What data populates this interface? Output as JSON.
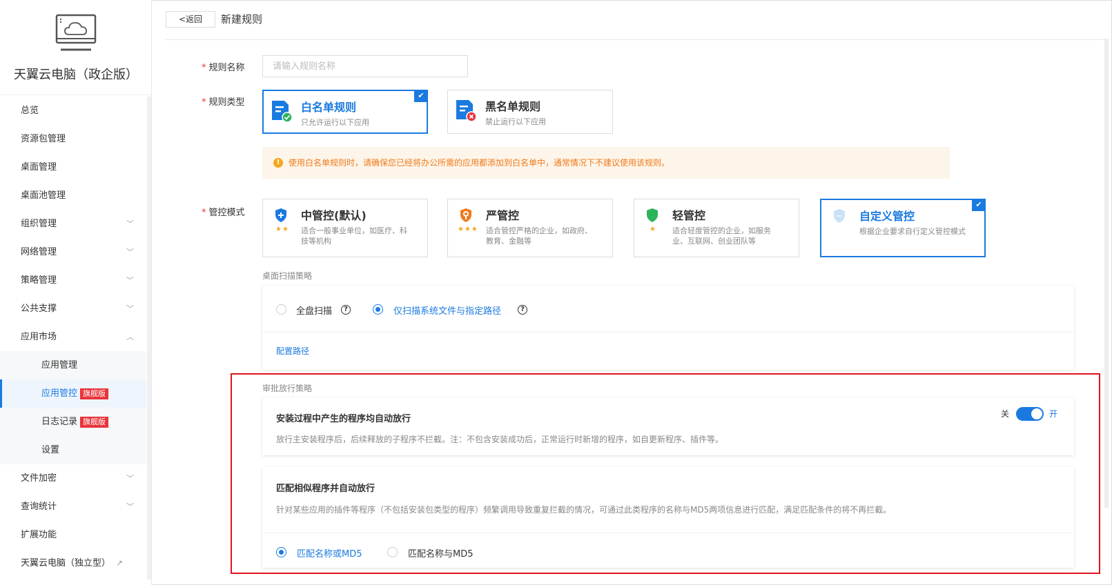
{
  "sidebar": {
    "app_title": "天翼云电脑（政企版）",
    "items": [
      {
        "label": "总览",
        "chevron": ""
      },
      {
        "label": "资源包管理",
        "chevron": ""
      },
      {
        "label": "桌面管理",
        "chevron": ""
      },
      {
        "label": "桌面池管理",
        "chevron": ""
      },
      {
        "label": "组织管理",
        "chevron": "﹀"
      },
      {
        "label": "网络管理",
        "chevron": "﹀"
      },
      {
        "label": "策略管理",
        "chevron": "﹀"
      },
      {
        "label": "公共支撑",
        "chevron": "﹀"
      },
      {
        "label": "应用市场",
        "chevron": "︿"
      },
      {
        "label": "应用管理",
        "chevron": ""
      },
      {
        "label": "应用管控",
        "badge": "旗舰版"
      },
      {
        "label": "日志记录",
        "badge": "旗舰版"
      },
      {
        "label": "设置",
        "chevron": ""
      },
      {
        "label": "文件加密",
        "chevron": "﹀"
      },
      {
        "label": "查询统计",
        "chevron": "﹀"
      },
      {
        "label": "扩展功能",
        "chevron": ""
      },
      {
        "label": "天翼云电脑（独立型）",
        "chevron": ""
      }
    ]
  },
  "header": {
    "back_label": "<返回",
    "title": "新建规则"
  },
  "form": {
    "name_label": "规则名称",
    "name_placeholder": "请输入规则名称",
    "type_label": "规则类型",
    "type_cards": [
      {
        "title": "白名单规则",
        "desc": "只允许运行以下应用"
      },
      {
        "title": "黑名单规则",
        "desc": "禁止运行以下应用"
      }
    ],
    "warning": "使用白名单规则时，请确保您已经将办公所需的应用都添加到白名单中，通常情况下不建议使用该规则。",
    "mode_label": "管控模式",
    "mode_cards": [
      {
        "title": "中管控(默认)",
        "stars": "★★",
        "desc1": "适合一般事业单位，如医疗、科",
        "desc2": "技等机构"
      },
      {
        "title": "严管控",
        "stars": "★★★",
        "desc1": "适合管控严格的企业，如政府、",
        "desc2": "教育、金融等"
      },
      {
        "title": "轻管控",
        "stars": "★",
        "desc1": "适合轻度管控的企业，如服务",
        "desc2": "业、互联网、创业团队等"
      },
      {
        "title": "自定义管控",
        "desc1": "根据企业要求自行定义管控模式"
      }
    ]
  },
  "scan": {
    "section_label": "桌面扫描策略",
    "option_full": "全盘扫描",
    "option_system": "仅扫描系统文件与指定路径",
    "config_link": "配置路径"
  },
  "approval": {
    "section_label": "审批放行策略",
    "install": {
      "title": "安装过程中产生的程序均自动放行",
      "desc": "放行主安装程序后，后续释放的子程序不拦截。注：不包含安装成功后，正常运行时新增的程序，如自更新程序、插件等。",
      "off_label": "关",
      "on_label": "开"
    },
    "match": {
      "title": "匹配相似程序并自动放行",
      "desc": "针对某些应用的插件等程序（不包括安装包类型的程序）频繁调用导致重复拦截的情况，可通过此类程序的名称与MD5两项信息进行匹配，满足匹配条件的将不再拦截。",
      "option_or": "匹配名称或MD5",
      "option_and": "匹配名称与MD5"
    }
  },
  "colors": {
    "accent": "#1a7ae0",
    "danger": "#e0121e",
    "warning": "#f07a1c"
  }
}
